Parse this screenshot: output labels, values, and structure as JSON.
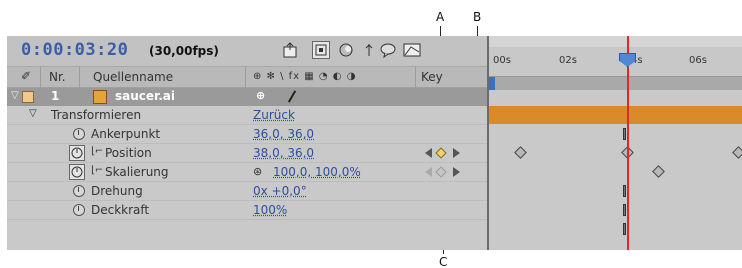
{
  "callouts": {
    "a": "A",
    "b": "B",
    "c": "C"
  },
  "header": {
    "timecode": "0:00:03:20",
    "fps": "(30,00fps)",
    "ruler_ticks": [
      "00s",
      "02s",
      "4s",
      "06s"
    ]
  },
  "columns": {
    "nr": "Nr.",
    "source": "Quellenname",
    "switches": "⊕ ✻ \\ fx ▦ ◔ ◐ ◑",
    "keys": "Key"
  },
  "layer": {
    "number": "1",
    "name": "saucer.ai"
  },
  "transform": {
    "label": "Transformieren",
    "reset": "Zurück"
  },
  "properties": [
    {
      "label": "Ankerpunkt",
      "value": "36,0, 36,0"
    },
    {
      "label": "Position",
      "value": "38,0, 36,0"
    },
    {
      "label": "Skalierung",
      "value": "100,0, 100,0%"
    },
    {
      "label": "Drehung",
      "value": "0x +0,0°"
    },
    {
      "label": "Deckkraft",
      "value": "100%"
    }
  ],
  "colors": {
    "timecode": "#3a5ea8",
    "playhead": "#e3262a",
    "layer_bar": "#d98a2b",
    "value_link": "#2d4f9c"
  },
  "icons": [
    "pickwhip-icon",
    "composition-icon",
    "render-icon",
    "lock-icon",
    "comment-icon",
    "graph-icon",
    "stopwatch-icon",
    "eye-icon",
    "label-color-icon",
    "ai-file-icon",
    "keyframe-nav-prev-icon",
    "keyframe-add-icon",
    "keyframe-nav-next-icon",
    "playhead-handle-icon"
  ]
}
